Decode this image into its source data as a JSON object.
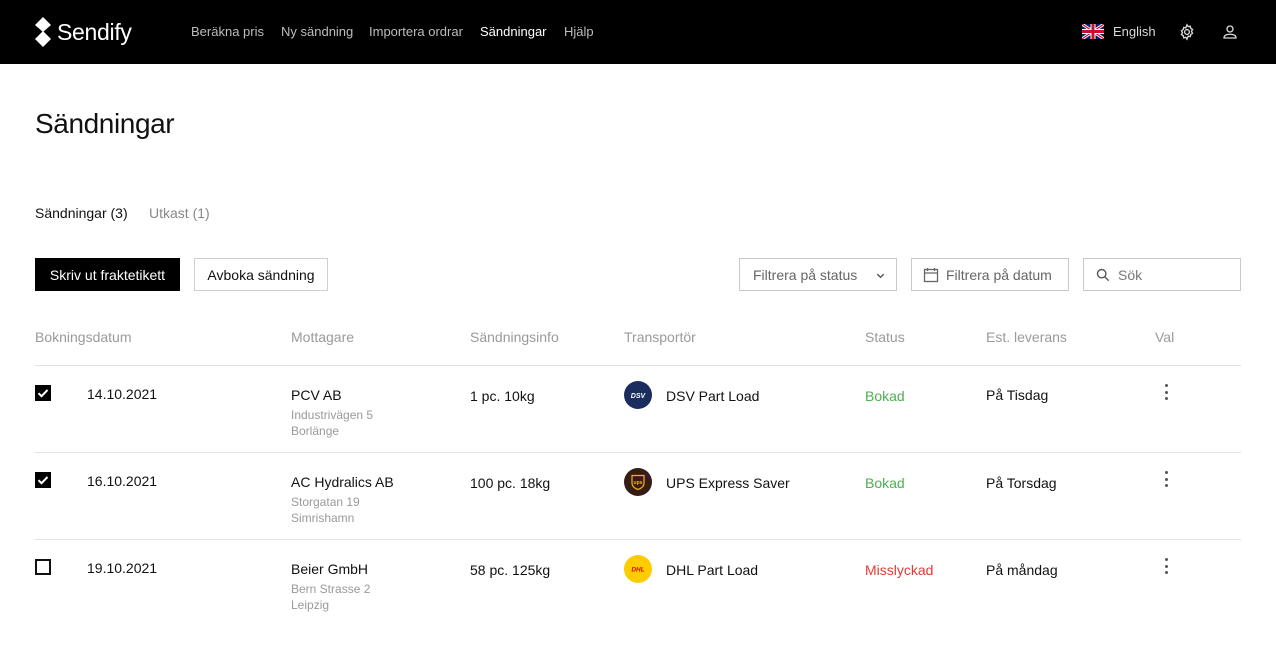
{
  "brand": {
    "name": "Sendify"
  },
  "nav": {
    "items": [
      {
        "label": "Beräkna pris"
      },
      {
        "label": "Ny sändning"
      },
      {
        "label": "Importera ordrar"
      },
      {
        "label": "Sändningar",
        "active": true
      },
      {
        "label": "Hjälp"
      }
    ],
    "language": "English"
  },
  "page": {
    "title": "Sändningar"
  },
  "tabs": [
    {
      "label": "Sändningar (3)",
      "active": true
    },
    {
      "label": "Utkast (1)",
      "active": false
    }
  ],
  "actions": {
    "print_label": "Skriv ut fraktetikett",
    "cancel_label": "Avboka sändning"
  },
  "filters": {
    "status_placeholder": "Filtrera på status",
    "date_placeholder": "Filtrera på datum",
    "search_placeholder": "Sök"
  },
  "table": {
    "headers": [
      "Bokningsdatum",
      "Mottagare",
      "Sändningsinfo",
      "Transportör",
      "Status",
      "Est. leverans",
      "Val"
    ],
    "rows": [
      {
        "checked": true,
        "date": "14.10.2021",
        "recipient": "PCV AB",
        "street": "Industrivägen 5",
        "city": "Borlänge",
        "info": "1 pc. 10kg",
        "carrier": "DSV Part Load",
        "carrier_logo": "dsv-logo",
        "status": "Bokad",
        "status_color": "#4caf50",
        "eta": "På Tisdag"
      },
      {
        "checked": true,
        "date": "16.10.2021",
        "recipient": "AC Hydralics AB",
        "street": "Storgatan 19",
        "city": "Simrishamn",
        "info": "100 pc. 18kg",
        "carrier": "UPS Express Saver",
        "carrier_logo": "ups-logo",
        "status": "Bokad",
        "status_color": "#4caf50",
        "eta": "På Torsdag"
      },
      {
        "checked": false,
        "date": "19.10.2021",
        "recipient": "Beier GmbH",
        "street": "Bern Strasse 2",
        "city": "Leipzig",
        "info": "58 pc. 125kg",
        "carrier": "DHL Part Load",
        "carrier_logo": "dhl-logo",
        "status": "Misslyckad",
        "status_color": "#e53935",
        "eta": "På måndag"
      }
    ]
  },
  "colors": {
    "topbar": "#000000",
    "primary_button": "#000000",
    "status_ok": "#4caf50",
    "status_fail": "#e53935"
  }
}
